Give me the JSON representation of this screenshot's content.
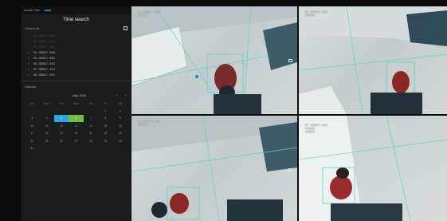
{
  "left_panel": {
    "top_label": "Analytic View",
    "tabs": [
      "",
      "",
      ""
    ],
    "title": "Time search",
    "search_list_label": "Camera list",
    "search_list": [
      {
        "label": "01 - 02/8/17 - 9:00",
        "state": "off"
      },
      {
        "label": "02 - 02/8/17 - 9:00",
        "state": "off"
      },
      {
        "label": "03 - 02/8/17 - 9:00",
        "state": "off"
      },
      {
        "label": "04 - 02/8/17 - 9:00",
        "state": "on"
      },
      {
        "label": "05 - 02/8/17 - 9:01",
        "state": "on"
      },
      {
        "label": "06 - 02/8/17 - 9:01",
        "state": "on"
      },
      {
        "label": "07 - 02/8/17 - 9:01",
        "state": "on"
      },
      {
        "label": "08 - 02/8/17 - 9:01",
        "state": "on"
      }
    ],
    "calendar_label": "Calendar",
    "calendar": {
      "month": "July, 2016",
      "weekdays": [
        "Sun",
        "Mon",
        "Tue",
        "Wed",
        "Thu",
        "Fri",
        "Sat"
      ],
      "days": [
        "",
        "",
        "",
        "",
        "",
        "1",
        "2",
        "3",
        "4",
        "5",
        "6",
        "7",
        "8",
        "9",
        "10",
        "11",
        "12",
        "13",
        "14",
        "15",
        "16",
        "17",
        "18",
        "19",
        "20",
        "21",
        "22",
        "23",
        "24",
        "25",
        "26",
        "27",
        "28",
        "29",
        "30",
        "31",
        "",
        "",
        "",
        "",
        "",
        ""
      ],
      "highlight_blue": "5",
      "highlight_green": "6"
    }
  },
  "cameras": [
    {
      "id": "cam1",
      "lines": [
        "01 - 02/8/17 - 9:00",
        "Analytic"
      ]
    },
    {
      "id": "cam2",
      "lines": [
        "05 - 02/8/17 - 9:00",
        "Analytic"
      ]
    },
    {
      "id": "cam3",
      "lines": [
        "05 - 02/8/17 - 9:00",
        "Analytic"
      ]
    },
    {
      "id": "cam4",
      "lines": [
        "07 - 02/8/17 - 9:01",
        "Analytic",
        "Analytic"
      ]
    }
  ],
  "colors": {
    "accent": "#2aa7e2",
    "green": "#6fc043",
    "overlay": "#5fd3c6",
    "bg_dark": "#1a1c1e"
  }
}
